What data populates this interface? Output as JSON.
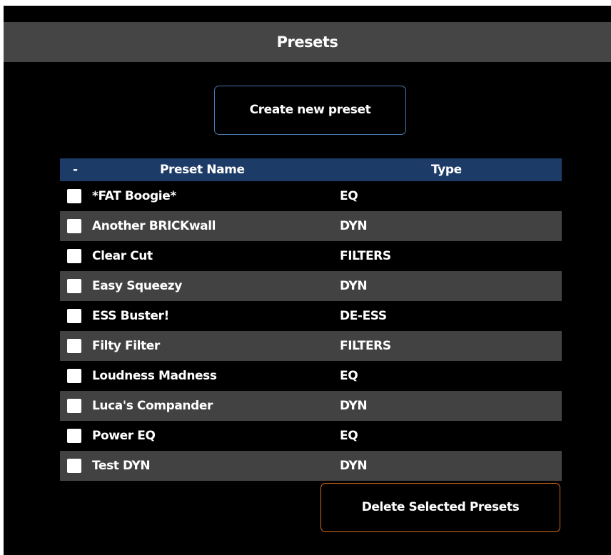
{
  "header": {
    "title": "Presets"
  },
  "actions": {
    "create_label": "Create new preset",
    "delete_label": "Delete Selected Presets"
  },
  "table": {
    "columns": {
      "select": "-",
      "name": "Preset Name",
      "type": "Type"
    },
    "rows": [
      {
        "name": "*FAT Boogie*",
        "type": "EQ",
        "checked": false
      },
      {
        "name": "Another BRICKwall",
        "type": "DYN",
        "checked": false
      },
      {
        "name": "Clear Cut",
        "type": "FILTERS",
        "checked": false
      },
      {
        "name": "Easy Squeezy",
        "type": "DYN",
        "checked": false
      },
      {
        "name": "ESS Buster!",
        "type": "DE-ESS",
        "checked": false
      },
      {
        "name": "Filty Filter",
        "type": "FILTERS",
        "checked": false
      },
      {
        "name": "Loudness Madness",
        "type": "EQ",
        "checked": false
      },
      {
        "name": "Luca's Compander",
        "type": "DYN",
        "checked": false
      },
      {
        "name": "Power EQ",
        "type": "EQ",
        "checked": false
      },
      {
        "name": "Test DYN",
        "type": "DYN",
        "checked": false
      }
    ]
  },
  "colors": {
    "header_bg": "#454545",
    "table_header_bg": "#1c3b66",
    "row_alt_bg": "#424242",
    "create_border": "#4a78b4",
    "delete_border": "#d06a1a"
  }
}
